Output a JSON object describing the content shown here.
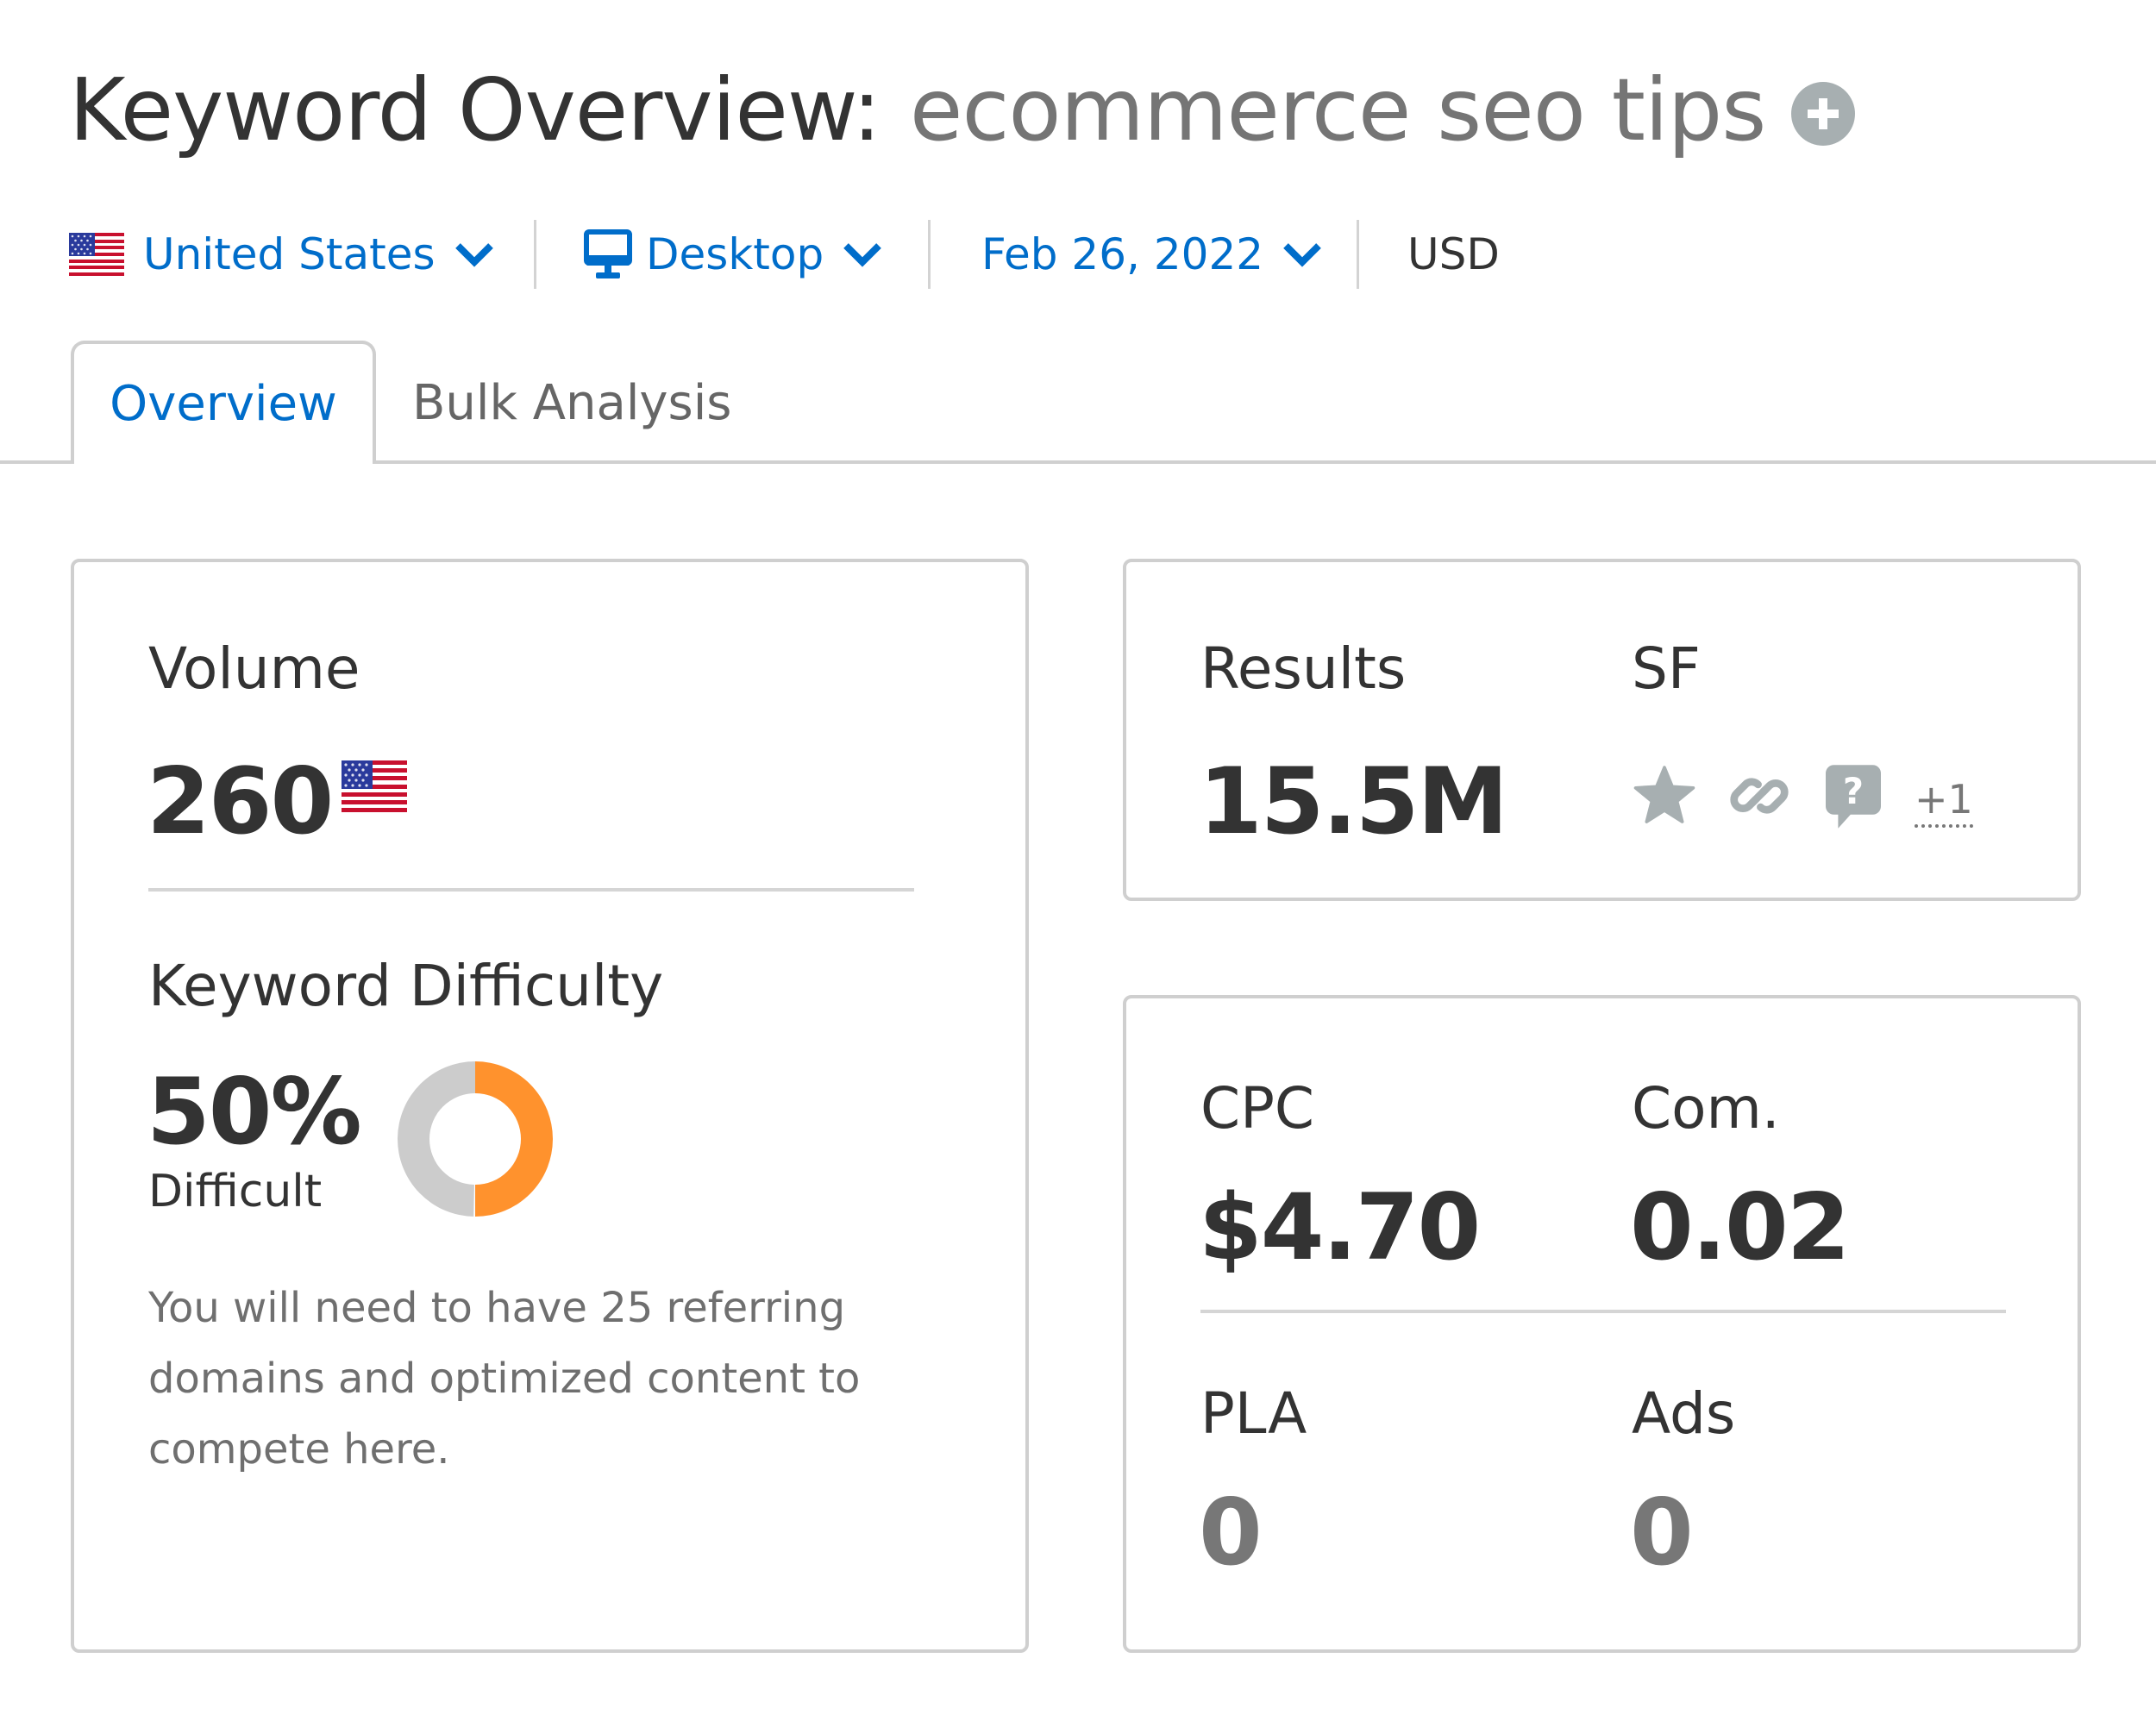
{
  "header": {
    "title_prefix": "Keyword Overview:",
    "keyword": "ecommerce seo tips",
    "add_keyword_icon": "plus-circle-icon"
  },
  "filters": {
    "country": {
      "label": "United States",
      "icon": "us-flag-icon"
    },
    "device": {
      "label": "Desktop",
      "icon": "monitor-icon"
    },
    "date": {
      "label": "Feb 26, 2022"
    },
    "currency": "USD"
  },
  "tabs": [
    {
      "label": "Overview",
      "active": true
    },
    {
      "label": "Bulk Analysis",
      "active": false
    }
  ],
  "volume": {
    "label": "Volume",
    "value": "260",
    "flag_icon": "us-flag-icon"
  },
  "keyword_difficulty": {
    "label": "Keyword Difficulty",
    "value": "50%",
    "percent": 50,
    "level": "Difficult",
    "description": "You will need to have 25 referring domains and optimized content to compete here.",
    "colors": {
      "filled": "#FF922D",
      "empty": "#CCCCCC"
    }
  },
  "results": {
    "label": "Results",
    "value": "15.5M"
  },
  "serp_features": {
    "label": "SF",
    "icons": [
      "star-icon",
      "link-icon",
      "question-bubble-icon"
    ],
    "more": "+1"
  },
  "cpc": {
    "label": "CPC",
    "value": "$4.70"
  },
  "competition": {
    "label": "Com.",
    "value": "0.02"
  },
  "pla": {
    "label": "PLA",
    "value": "0"
  },
  "ads": {
    "label": "Ads",
    "value": "0"
  },
  "colors": {
    "accent_blue": "#006DCA",
    "text_dark": "#333333",
    "text_muted": "#757575",
    "icon_gray": "#A7AFB1",
    "border": "#CFCFCF"
  }
}
